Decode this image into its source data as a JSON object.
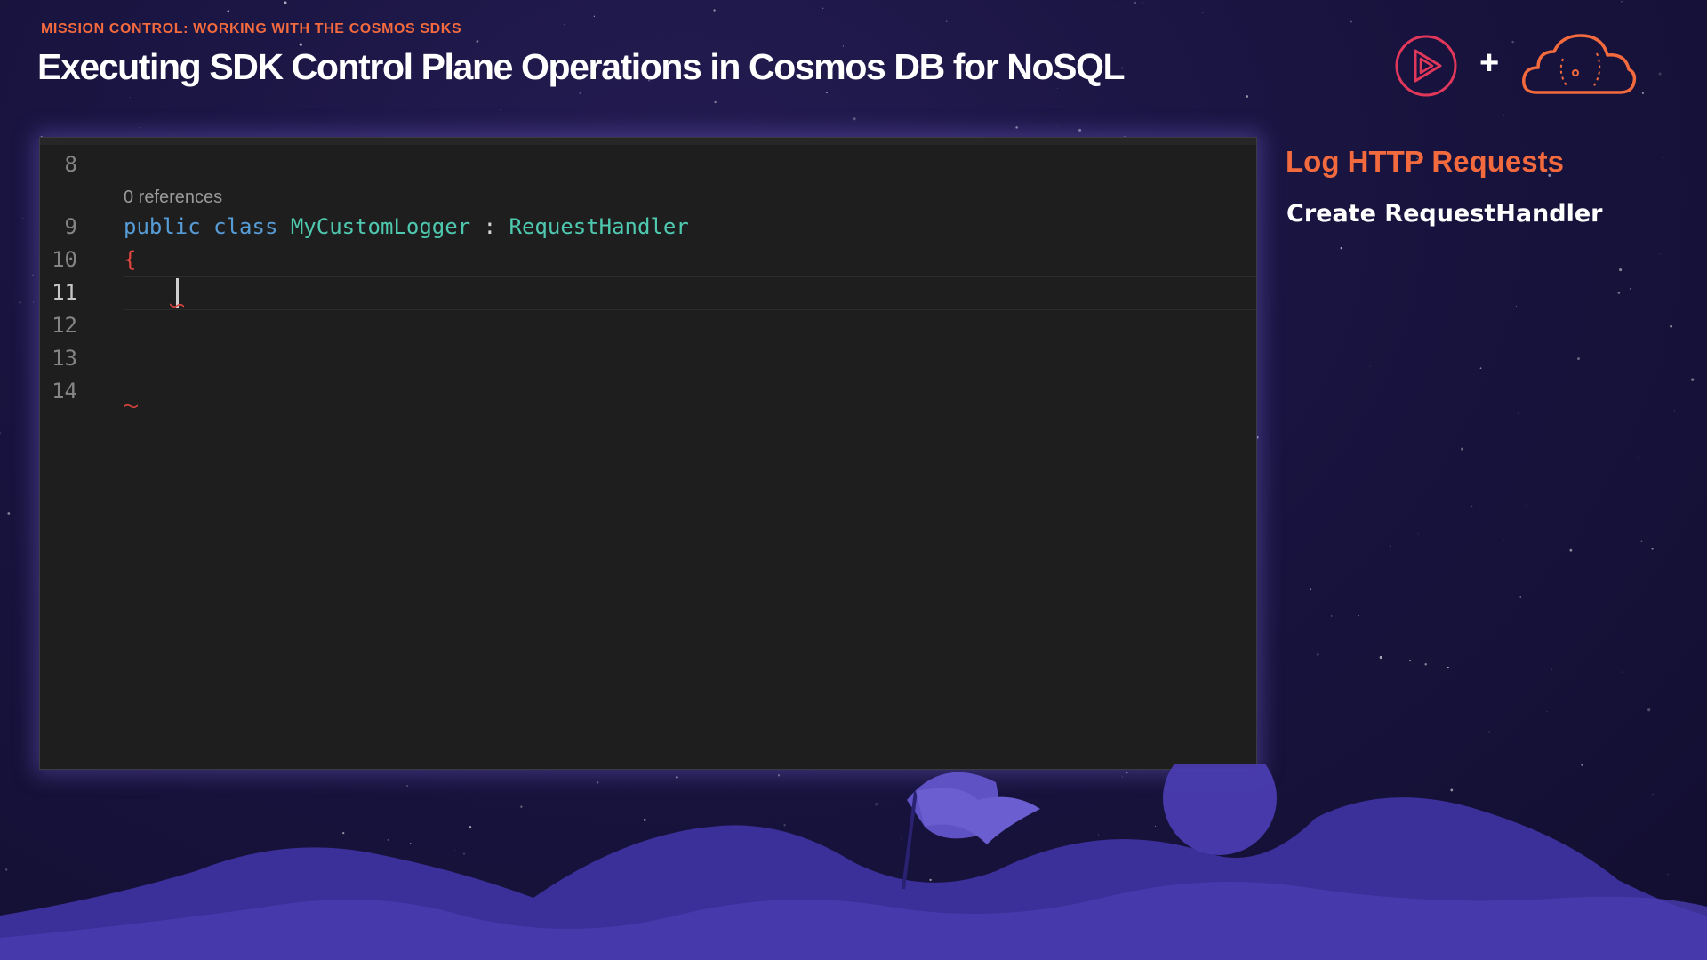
{
  "header": {
    "subtitle": "MISSION CONTROL: WORKING WITH THE COSMOS SDKS",
    "title": "Executing SDK Control Plane Operations in Cosmos DB for NoSQL",
    "plus": "+"
  },
  "editor": {
    "codelens": "0 references",
    "line_numbers": [
      "8",
      "9",
      "10",
      "11",
      "12",
      "13",
      "14"
    ],
    "active_line": "11",
    "line9": {
      "kw1": "public",
      "kw2": "class",
      "class_name": "MyCustomLogger",
      "colon": ":",
      "base_type": "RequestHandler"
    },
    "line10": "{"
  },
  "sidebar": {
    "title": "Log HTTP Requests",
    "step": "Create RequestHandler"
  },
  "colors": {
    "accent": "#f26a3d",
    "keyword": "#569cd6",
    "type": "#4ec9b0",
    "brace": "#e0463e",
    "background": "#191440"
  },
  "icons": [
    "play-icon",
    "plus-icon",
    "cloud-icon"
  ]
}
